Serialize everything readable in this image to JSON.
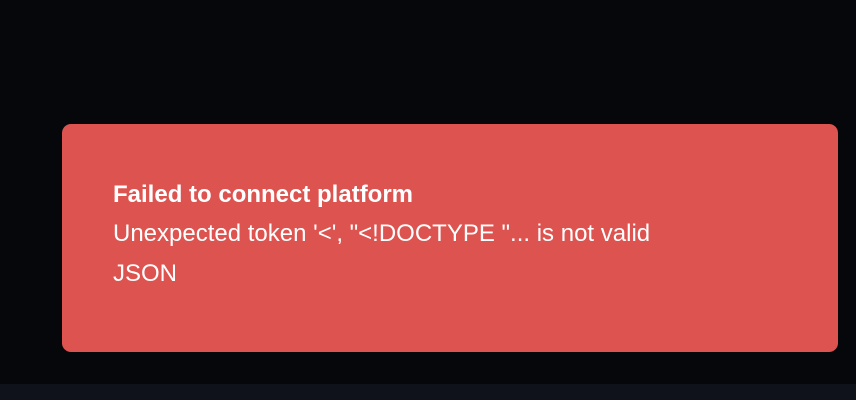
{
  "toast": {
    "title": "Failed to connect platform",
    "message": "Unexpected token '<', \"<!DOCTYPE \"... is not valid JSON"
  },
  "colors": {
    "background": "#06070b",
    "toast_background": "#dd534f",
    "text": "#ffffff",
    "bottom_strip": "#0f121b"
  }
}
